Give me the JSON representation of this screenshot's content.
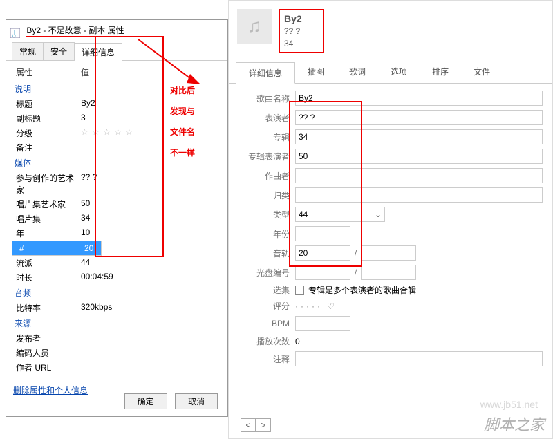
{
  "left": {
    "title": "By2 - 不是故意 - 副本 属性",
    "tabs": [
      "常规",
      "安全",
      "详细信息"
    ],
    "head_attr": "属性",
    "head_val": "值",
    "sections": {
      "desc": "说明",
      "media": "媒体",
      "audio": "音频",
      "source": "来源"
    },
    "rows": {
      "title_l": "标题",
      "title_v": "By2",
      "subtitle_l": "副标题",
      "subtitle_v": "3",
      "rating_l": "分级",
      "rating_v": "☆ ☆ ☆ ☆ ☆",
      "note_l": "备注",
      "note_v": "",
      "artist_l": "参与创作的艺术家",
      "artist_v": "?? ?",
      "albumartist_l": "唱片集艺术家",
      "albumartist_v": "50",
      "album_l": "唱片集",
      "album_v": "34",
      "year_l": "年",
      "year_v": "10",
      "num_l": "#",
      "num_v": "20",
      "genre_l": "流派",
      "genre_v": "44",
      "len_l": "时长",
      "len_v": "00:04:59",
      "bitrate_l": "比特率",
      "bitrate_v": "320kbps",
      "pub_l": "发布者",
      "enc_l": "编码人员",
      "url_l": "作者 URL"
    },
    "link": "删除属性和个人信息",
    "ok": "确定",
    "cancel": "取消"
  },
  "anno": {
    "l1": "对比后",
    "l2": "发现与",
    "l3": "文件名",
    "l4": "不一样"
  },
  "right": {
    "meta": {
      "t1": "By2",
      "t2": "?? ?",
      "t3": "34"
    },
    "tabs": [
      "详细信息",
      "插图",
      "歌词",
      "选项",
      "排序",
      "文件"
    ],
    "labels": {
      "song": "歌曲名称",
      "perf": "表演者",
      "album": "专辑",
      "albperf": "专辑表演者",
      "composer": "作曲者",
      "cat": "归类",
      "type": "类型",
      "year": "年份",
      "track": "音轨",
      "disc": "光盘编号",
      "opt": "选集",
      "optlabel": "专辑是多个表演者的歌曲合辑",
      "rate": "评分",
      "bpm": "BPM",
      "play": "播放次数",
      "note": "注释"
    },
    "vals": {
      "song": "By2",
      "perf": "?? ?",
      "album": "34",
      "albperf": "50",
      "type": "44",
      "track": "20",
      "play": "0"
    }
  },
  "watermark": "脚本之家",
  "wm": "www.jb51.net"
}
